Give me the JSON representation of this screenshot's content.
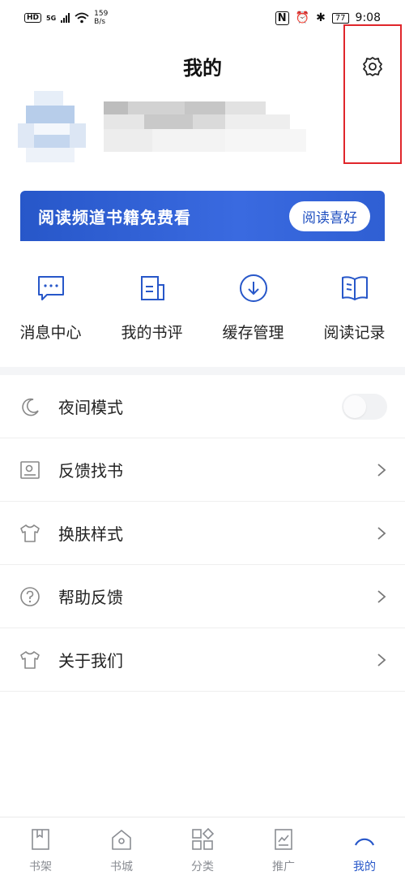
{
  "status_bar": {
    "hd": "HD",
    "net_type": "5G",
    "net_speed_value": "159",
    "net_speed_unit": "B/s",
    "battery": "77",
    "time": "9:08"
  },
  "header": {
    "title": "我的"
  },
  "banner": {
    "text": "阅读频道书籍免费看",
    "button_label": "阅读喜好"
  },
  "quick_actions": [
    {
      "label": "消息中心",
      "icon": "message-icon"
    },
    {
      "label": "我的书评",
      "icon": "book-review-icon"
    },
    {
      "label": "缓存管理",
      "icon": "download-icon"
    },
    {
      "label": "阅读记录",
      "icon": "open-book-icon"
    }
  ],
  "menu": [
    {
      "label": "夜间模式",
      "icon": "moon-icon",
      "toggle_on": false
    },
    {
      "label": "反馈找书",
      "icon": "find-book-icon"
    },
    {
      "label": "换肤样式",
      "icon": "shirt-icon"
    },
    {
      "label": "帮助反馈",
      "icon": "help-icon"
    },
    {
      "label": "关于我们",
      "icon": "shirt-icon"
    }
  ],
  "bottom_nav": [
    {
      "label": "书架",
      "icon": "bookshelf-icon",
      "active": false
    },
    {
      "label": "书城",
      "icon": "bookstore-icon",
      "active": false
    },
    {
      "label": "分类",
      "icon": "category-icon",
      "active": false
    },
    {
      "label": "推广",
      "icon": "promotion-icon",
      "active": false
    },
    {
      "label": "我的",
      "icon": "profile-icon",
      "active": true
    }
  ],
  "colors": {
    "accent": "#2757c9",
    "highlight": "#e0262b",
    "text": "#222222",
    "muted": "#8a8d93"
  }
}
